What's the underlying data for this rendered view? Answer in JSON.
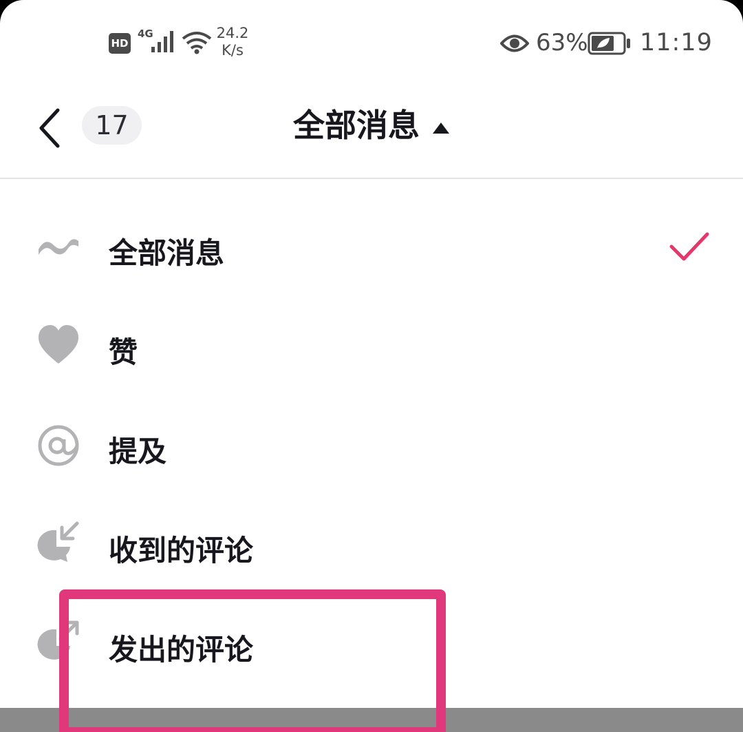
{
  "status_bar": {
    "hd": "HD",
    "network": "4G",
    "speed_value": "24.2",
    "speed_unit": "K/s",
    "battery_percent": "63%",
    "time": "11:19"
  },
  "header": {
    "count": "17",
    "title": "全部消息"
  },
  "menu": {
    "items": [
      {
        "label": "全部消息",
        "icon": "wave-icon",
        "selected": true
      },
      {
        "label": "赞",
        "icon": "heart-icon",
        "selected": false
      },
      {
        "label": "提及",
        "icon": "at-icon",
        "selected": false
      },
      {
        "label": "收到的评论",
        "icon": "comment-received-icon",
        "selected": false
      },
      {
        "label": "发出的评论",
        "icon": "comment-sent-icon",
        "selected": false
      }
    ]
  },
  "colors": {
    "accent": "#e5386a",
    "highlight": "#e0387a",
    "icon_gray": "#b3b3b6",
    "text": "#16181d"
  }
}
